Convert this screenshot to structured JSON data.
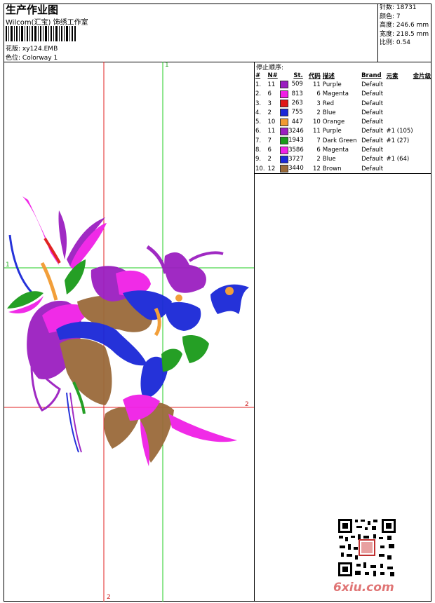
{
  "header": {
    "title": "生产作业图",
    "company": "Wilcom(汇宝) 饰绣工作室",
    "design_label": "花版:",
    "design_file": "xy124.EMB",
    "colorway_label": "色位:",
    "colorway": "Colorway 1"
  },
  "stats": {
    "stitches_label": "针数:",
    "stitches": "18731",
    "colors_label": "颜色:",
    "colors": "7",
    "height_label": "高度:",
    "height": "246.6 mm",
    "width_label": "宽度:",
    "width": "218.5 mm",
    "scale_label": "比例:",
    "scale": "0.54"
  },
  "stop_sequence": {
    "title": "停止顺序:",
    "headers": [
      "#",
      "N#",
      "St.",
      "代码",
      "描述",
      "Brand",
      "元素",
      "金片级"
    ],
    "rows": [
      {
        "n": "1.",
        "needle": "11",
        "color": "#9b1fc0",
        "st": "509",
        "code": "11",
        "desc": "Purple",
        "brand": "Default",
        "element": "",
        "sequin": ""
      },
      {
        "n": "2.",
        "needle": "6",
        "color": "#f020e6",
        "st": "813",
        "code": "6",
        "desc": "Magenta",
        "brand": "Default",
        "element": "",
        "sequin": ""
      },
      {
        "n": "3.",
        "needle": "3",
        "color": "#e01818",
        "st": "263",
        "code": "3",
        "desc": "Red",
        "brand": "Default",
        "element": "",
        "sequin": ""
      },
      {
        "n": "4.",
        "needle": "2",
        "color": "#1a28d8",
        "st": "755",
        "code": "2",
        "desc": "Blue",
        "brand": "Default",
        "element": "",
        "sequin": ""
      },
      {
        "n": "5.",
        "needle": "10",
        "color": "#f29a30",
        "st": "447",
        "code": "10",
        "desc": "Orange",
        "brand": "Default",
        "element": "",
        "sequin": ""
      },
      {
        "n": "6.",
        "needle": "11",
        "color": "#9b1fc0",
        "st": "3246",
        "code": "11",
        "desc": "Purple",
        "brand": "Default",
        "element": "#1 (105)",
        "sequin": ""
      },
      {
        "n": "7.",
        "needle": "7",
        "color": "#1a9a1a",
        "st": "1943",
        "code": "7",
        "desc": "Dark Green",
        "brand": "Default",
        "element": "#1 (27)",
        "sequin": ""
      },
      {
        "n": "8.",
        "needle": "6",
        "color": "#f020e6",
        "st": "3586",
        "code": "6",
        "desc": "Magenta",
        "brand": "Default",
        "element": "",
        "sequin": ""
      },
      {
        "n": "9.",
        "needle": "2",
        "color": "#1a28d8",
        "st": "3727",
        "code": "2",
        "desc": "Blue",
        "brand": "Default",
        "element": "#1 (64)",
        "sequin": ""
      },
      {
        "n": "10.",
        "needle": "12",
        "color": "#9a6a3a",
        "st": "3440",
        "code": "12",
        "desc": "Brown",
        "brand": "Default",
        "element": "",
        "sequin": ""
      }
    ]
  },
  "guides": {
    "green_v_label": "1",
    "green_h_label": "1",
    "red_h_label": "2",
    "red_v_label": "2"
  },
  "watermark": "6xiu.com"
}
